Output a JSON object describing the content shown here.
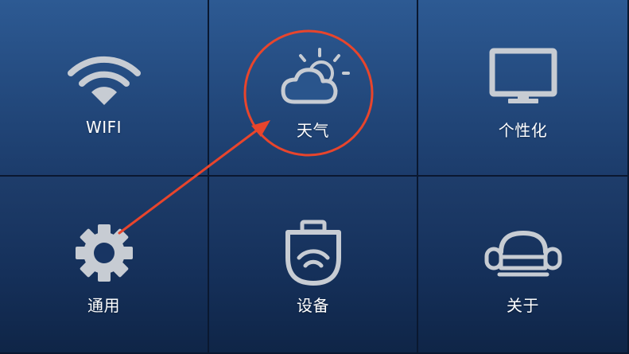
{
  "tiles": [
    {
      "label": "WIFI",
      "icon": "wifi-icon"
    },
    {
      "label": "天气",
      "icon": "weather-icon"
    },
    {
      "label": "个性化",
      "icon": "monitor-icon"
    },
    {
      "label": "通用",
      "icon": "gear-icon"
    },
    {
      "label": "设备",
      "icon": "device-icon"
    },
    {
      "label": "关于",
      "icon": "sofa-icon"
    }
  ],
  "annotation": {
    "color": "#e8452c",
    "target": "天气",
    "source": "通用"
  },
  "colors": {
    "tile_top_row": "#2a558c",
    "tile_bottom_row": "#183563",
    "icon": "#c7ccd3",
    "label": "#ffffff"
  }
}
